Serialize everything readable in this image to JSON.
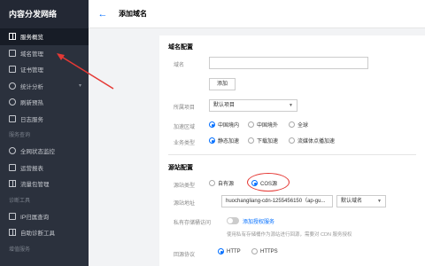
{
  "sidebar": {
    "title": "内容分发网络",
    "items": [
      {
        "label": "服务概览",
        "icon": "grid-icon"
      },
      {
        "label": "域名管理",
        "icon": "document-icon"
      },
      {
        "label": "证书管理",
        "icon": "certificate-icon"
      },
      {
        "label": "统计分析",
        "icon": "chart-icon"
      },
      {
        "label": "刷新预热",
        "icon": "refresh-icon"
      },
      {
        "label": "日志服务",
        "icon": "log-icon"
      }
    ],
    "section_monitor": "服务查询",
    "monitor_items": [
      {
        "label": "全网状态监控",
        "icon": "monitor-icon"
      },
      {
        "label": "运营报表",
        "icon": "report-icon"
      },
      {
        "label": "流量包管理",
        "icon": "package-icon"
      }
    ],
    "section_diag": "诊断工具",
    "diag_items": [
      {
        "label": "IP归属查询",
        "icon": "search-icon"
      },
      {
        "label": "自助诊断工具",
        "icon": "tool-icon"
      }
    ],
    "section_more": "增值服务"
  },
  "header": {
    "back_label": "←",
    "title": "添加域名"
  },
  "form": {
    "domain_section": "域名配置",
    "domain_label": "域名",
    "domain_value": "",
    "add_button": "添加",
    "project_label": "所属项目",
    "project_value": "默认项目",
    "region_label": "加速区域",
    "region_options": [
      "中国境内",
      "中国境外",
      "全球"
    ],
    "business_label": "业务类型",
    "business_options": [
      "静态加速",
      "下载加速",
      "流媒体点播加速"
    ],
    "origin_section": "源站配置",
    "origin_type_label": "源站类型",
    "origin_type_options": [
      "自有源",
      "COS源"
    ],
    "origin_addr_label": "源站地址",
    "origin_addr_value": "huochangliang-cdn-1255456150（ap-gu...",
    "origin_domain_select": "默认域名",
    "private_label": "私有存储桶访问",
    "authorize_link": "添加授权服务",
    "private_hint": "使用私有存储桶作为源站进行回源，需要对 CDN 服务授权",
    "protocol_label": "回源协议",
    "protocol_options": [
      "HTTP",
      "HTTPS"
    ]
  },
  "colors": {
    "sidebar_bg": "#2b313d",
    "accent": "#006eff",
    "annotation_red": "#e53935"
  }
}
